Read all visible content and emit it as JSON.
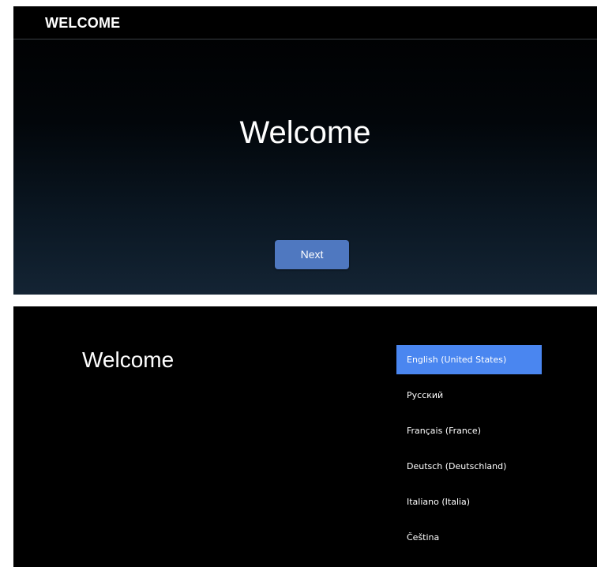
{
  "top_screen": {
    "header_title": "WELCOME",
    "welcome_text": "Welcome",
    "next_button": "Next"
  },
  "bottom_screen": {
    "welcome_text": "Welcome",
    "languages": [
      {
        "label": "English (United States)",
        "selected": true
      },
      {
        "label": "Русский",
        "selected": false
      },
      {
        "label": "Français (France)",
        "selected": false
      },
      {
        "label": "Deutsch (Deutschland)",
        "selected": false
      },
      {
        "label": "Italiano (Italia)",
        "selected": false
      },
      {
        "label": "Čeština",
        "selected": false
      }
    ]
  },
  "colors": {
    "accent_selected": "#4a86f0",
    "button_bg": "#4f78c0",
    "background": "#000000"
  }
}
